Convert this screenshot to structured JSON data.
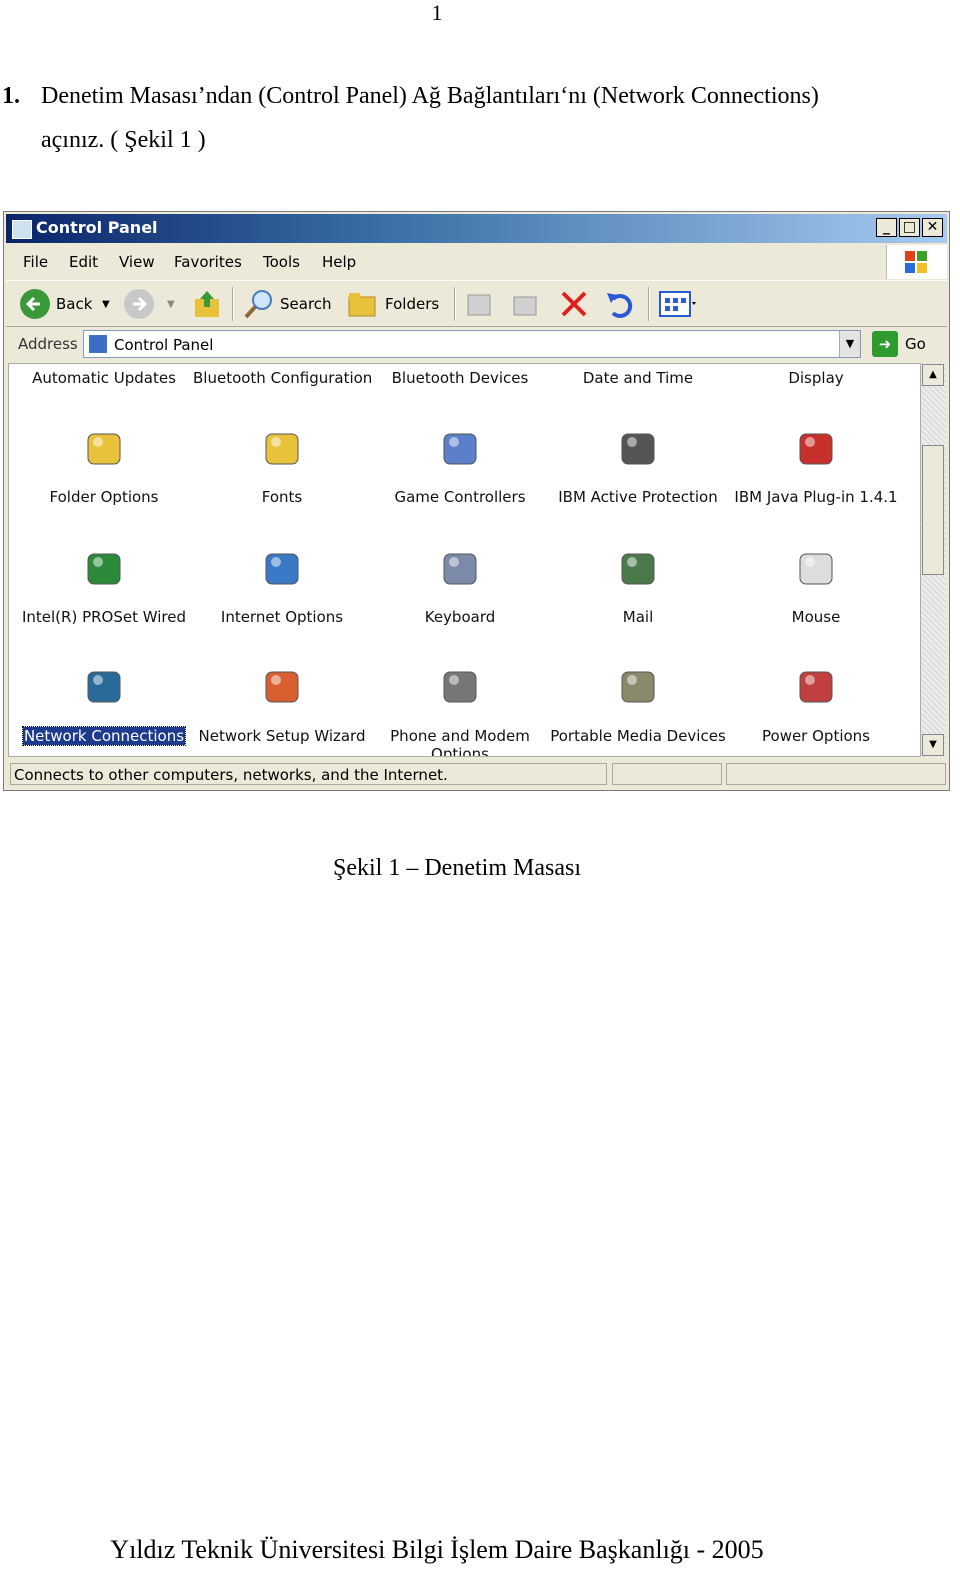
{
  "page_number": "1",
  "step": {
    "number": "1.",
    "line1": "Denetim Masası’ndan (Control Panel) Ağ Bağlantıları‘nı (Network Connections)",
    "line2": "açınız. ( Şekil 1 )"
  },
  "window": {
    "title": "Control Panel",
    "controls": {
      "minimize": "_",
      "maximize": "□",
      "close": "✕"
    },
    "menu": [
      "File",
      "Edit",
      "View",
      "Favorites",
      "Tools",
      "Help"
    ],
    "toolbar": {
      "back": "Back",
      "search": "Search",
      "folders": "Folders"
    },
    "address": {
      "label": "Address",
      "value": "Control Panel",
      "go": "Go"
    },
    "top_row": [
      "Automatic Updates",
      "Bluetooth Configuration",
      "Bluetooth Devices",
      "Date and Time",
      "Display"
    ],
    "items": [
      {
        "label": "Folder Options",
        "icon": "folder-options-icon",
        "color": "#e8c23a"
      },
      {
        "label": "Fonts",
        "icon": "fonts-icon",
        "color": "#e8c23a"
      },
      {
        "label": "Game Controllers",
        "icon": "game-controller-icon",
        "color": "#5b7fc8"
      },
      {
        "label": "IBM Active Protection",
        "icon": "ibm-active-protection-icon",
        "color": "#555555"
      },
      {
        "label": "IBM Java Plug-in 1.4.1",
        "icon": "java-icon",
        "color": "#c8302c"
      },
      {
        "label": "Intel(R) PROSet Wired",
        "icon": "intel-proset-icon",
        "color": "#2a8a3a"
      },
      {
        "label": "Internet Options",
        "icon": "internet-options-icon",
        "color": "#3a78c8"
      },
      {
        "label": "Keyboard",
        "icon": "keyboard-icon",
        "color": "#7a8aa8"
      },
      {
        "label": "Mail",
        "icon": "mail-icon",
        "color": "#4a7a4a"
      },
      {
        "label": "Mouse",
        "icon": "mouse-icon",
        "color": "#dddddd"
      },
      {
        "label": "Network Connections",
        "icon": "network-connections-icon",
        "color": "#2a6a9a"
      },
      {
        "label": "Network Setup Wizard",
        "icon": "network-setup-wizard-icon",
        "color": "#d86030"
      },
      {
        "label": "Phone and Modem",
        "icon": "phone-modem-icon",
        "color": "#777777"
      },
      {
        "label": "Portable Media Devices",
        "icon": "portable-media-icon",
        "color": "#8a8a6a"
      },
      {
        "label": "Power Options",
        "icon": "power-options-icon",
        "color": "#c04040"
      }
    ],
    "cut_label": "Options",
    "status": "Connects to other computers, networks, and the Internet."
  },
  "caption": "Şekil 1 – Denetim Masası",
  "footer": "Yıldız Teknik Üniversitesi Bilgi İşlem Daire Başkanlığı - 2005"
}
